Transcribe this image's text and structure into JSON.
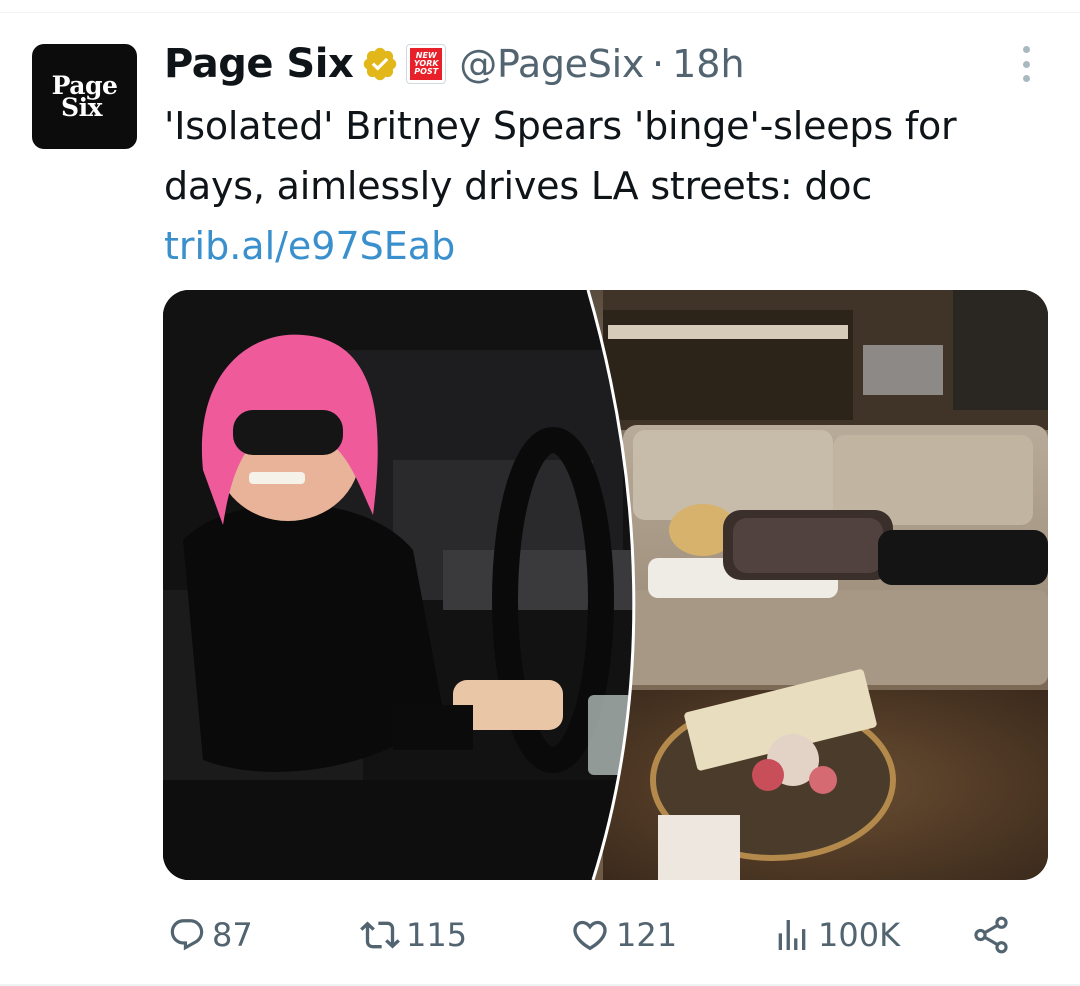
{
  "account": {
    "display_name": "Page Six",
    "handle": "@PageSix",
    "separator": "·",
    "time": "18h",
    "avatar_lines": [
      "Page",
      "Six"
    ],
    "affiliate_badge_text": [
      "NEW",
      "YORK",
      "POST"
    ],
    "verified_color": "#e2b719"
  },
  "tweet": {
    "lines": [
      "'Isolated' Britney Spears 'binge'-sleeps for",
      "days, aimlessly drives LA streets: doc"
    ],
    "link": "trib.al/e97SEab"
  },
  "media": {
    "description_icons": [
      "photo-left-car",
      "photo-right-couch"
    ]
  },
  "actions": {
    "replies": "87",
    "reposts": "115",
    "likes": "121",
    "views": "100K"
  },
  "icons": {
    "reply": "reply-icon",
    "repost": "repost-icon",
    "like": "heart-icon",
    "views": "views-icon",
    "share": "share-icon",
    "more": "more-dots-icon",
    "verified": "verified-badge-icon"
  },
  "colors": {
    "text": "#0f1419",
    "secondary": "#536471",
    "link": "#3a90cc",
    "badge_red": "#e8202a"
  }
}
